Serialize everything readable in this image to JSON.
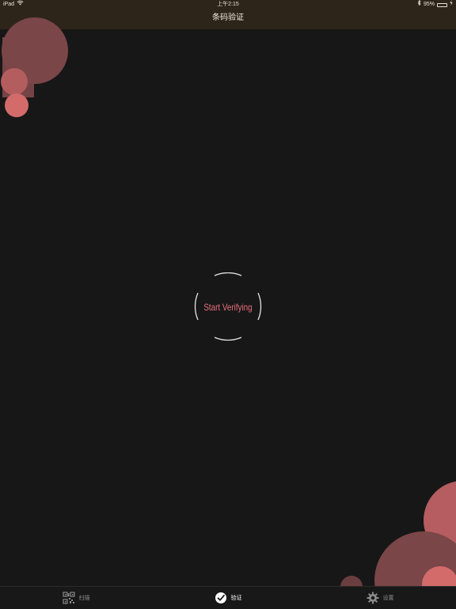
{
  "status_bar": {
    "device": "iPad",
    "time": "上午2:15",
    "battery": "95%",
    "battery_level": 0.95,
    "icons": [
      "wifi-icon",
      "bluetooth-icon",
      "battery-icon",
      "charging-icon"
    ]
  },
  "nav": {
    "title": "条码验证"
  },
  "main": {
    "verify_button_label": "Start Verifying",
    "accent_color": "#e8707e"
  },
  "tabs": [
    {
      "label": "扫描",
      "icon": "qrcode-icon",
      "active": false
    },
    {
      "label": "验证",
      "icon": "check-circle-icon",
      "active": true
    },
    {
      "label": "设置",
      "icon": "gear-icon",
      "active": false
    }
  ],
  "colors": {
    "background": "#181717",
    "topbar": "#2e251a",
    "bubble_light": "#d36b6b",
    "bubble_dark": "#7a4648"
  }
}
